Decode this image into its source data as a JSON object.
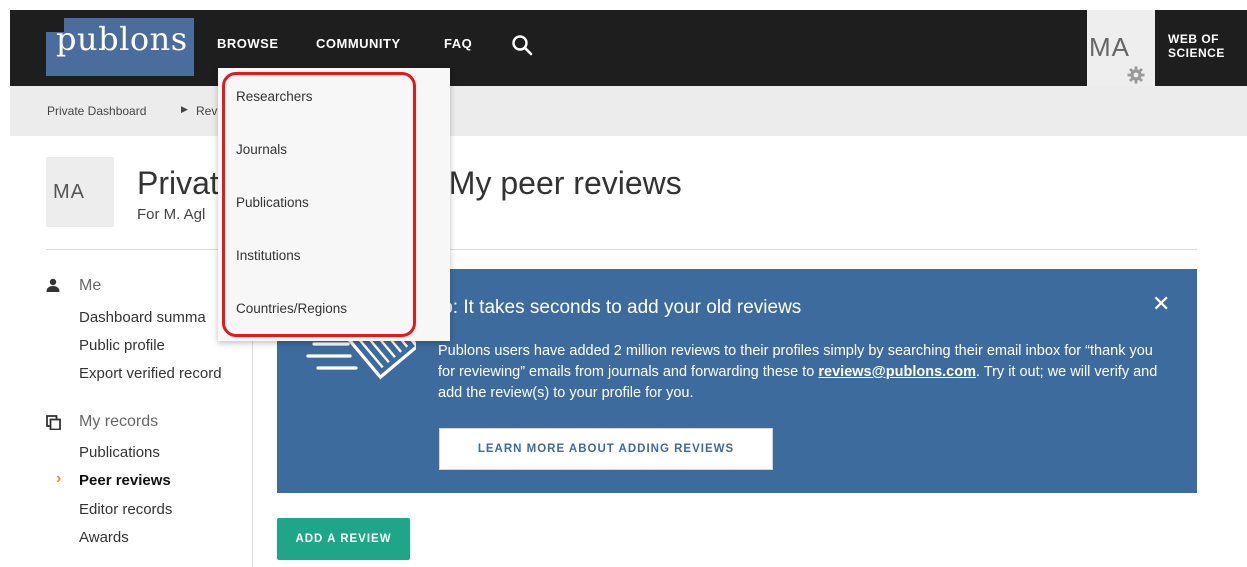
{
  "nav": {
    "logo": "publons",
    "items": [
      "BROWSE",
      "COMMUNITY",
      "FAQ"
    ],
    "avatar_initials": "MA",
    "web_of_science_line1": "WEB OF",
    "web_of_science_line2": "SCIENCE"
  },
  "breadcrumb": {
    "first": "Private Dashboard",
    "second": "Rev"
  },
  "browse_menu": {
    "items": [
      "Researchers",
      "Journals",
      "Publications",
      "Institutions",
      "Countries/Regions"
    ]
  },
  "header": {
    "initials": "MA",
    "title": "Privat                          My peer reviews",
    "title_left": "Privat",
    "title_right": "My peer reviews",
    "subtitle": "For M. Agl"
  },
  "sidebar": {
    "me_heading": "Me",
    "me_links": [
      "Dashboard summa",
      "Public profile",
      "Export verified record"
    ],
    "records_heading": "My records",
    "records_links": [
      "Publications",
      "Peer reviews",
      "Editor records",
      "Awards"
    ],
    "active": "Peer reviews"
  },
  "tip": {
    "title": "ip: It takes seconds to add your old reviews",
    "body_before": "Publons users have added 2 million reviews to their profiles simply by searching their email inbox for “thank you for reviewing” emails from journals and forwarding these to ",
    "body_link": "reviews@publons.com",
    "body_after": ". Try it out; we will verify and add the review(s) to your profile for you.",
    "learn_more_label": "LEARN MORE ABOUT ADDING REVIEWS"
  },
  "actions": {
    "add_review_label": "ADD A REVIEW"
  },
  "colors": {
    "topbar": "#1e1e1e",
    "logo": "#4a6d9e",
    "tip_background": "#3e6b9e",
    "add_button": "#1fa588",
    "highlight": "#e3191b",
    "active_chevron": "#e68a2e"
  }
}
